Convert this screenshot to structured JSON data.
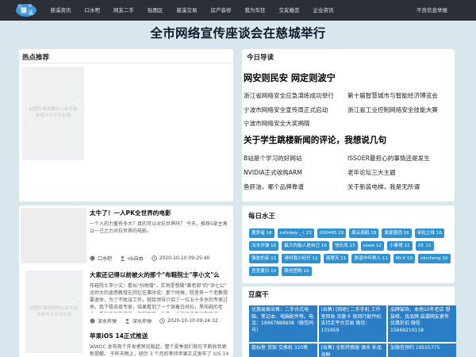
{
  "topbar": {
    "nav": [
      "慈溪资讯",
      "口水吧",
      "网友二手",
      "贴图区",
      "慈溪交易",
      "房产装修",
      "我为车狂",
      "交友婚恋",
      "企业资讯"
    ],
    "report": "不良信息举报"
  },
  "headline": "全市网络宣传座谈会在慈城举行",
  "hot": {
    "title": "热点推荐",
    "placeholder": [
      "此图片来自微信公众平台",
      "未经允许不可引用"
    ]
  },
  "guide": {
    "title": "今日导读",
    "h1a": "网安则民安 网定则波宁",
    "links_a": [
      "浙江省网络安全应急演练成功举行",
      "第十届智慧城市与智能经济博览会",
      "宁波市网络安全宣传周正式启动",
      "浙江省工业控制网络安全技能大赛",
      "宁波市网络安全大奖揭晓"
    ],
    "h1b": "关于学生跳楼新闻的评论，我想说几句",
    "links_b": [
      "B站是个学习的好网站",
      "ISSOER最担心的事情还是发生",
      "NVIDIA正式收购ARM",
      "老年论坛三大主题",
      "鱼肝油，哪个品牌靠谱",
      "关于新装电梯，我是无所谓"
    ]
  },
  "articles": [
    {
      "title": "太牛了！一人PK全世界的电影",
      "desc": "一个人的力量有多大？真的可以对抗世界吗？ 今天，推荐5部主角以一己之力对抗世界的电影。",
      "section": "口水吧",
      "author": "nb自由",
      "time": "2020-10-10 09:25:40"
    },
    {
      "title": "大家还记得以前被火的那个\"布鞋院士\"李小文\"么",
      "desc": "布鞋院士李小文：看似\"扫地僧\"，实则是想做\"黄老邪\"的\"洪七公\" 北师大的遥感教授在回忆往事时说：那个时候，院里有一个老教授要退休，为了不耽误工作，就给领导介绍了一位五十多岁的专家过来。我下楼去接专家，结果看到了一个穿着白衬衫，黑布鞋的老头，看起来有些邋遢，相貌平平，站在一个破旧的自行车旁边。",
      "placeholder": [
        "此图片来自微信公众平台",
        "未经允许不可引用"
      ],
      "section": "深水炸弹",
      "author": "深水炸弹",
      "time": "2020-10-10 09:24:32"
    },
    {
      "title": "苹果iOS 14正式推送",
      "desc": "WWDC 发布首个开发者预览版起，整个夏季我们就在不断收到更新提醒。 于昨天晚上，经历 3 个月的等待苹果正式发布了 iOS 14 正式版。",
      "section": "",
      "author": "",
      "time": ""
    }
  ],
  "water": {
    "title": "每日水王",
    "tags": [
      "噩梦者 16",
      "m0nkey-_-! 23",
      "000495 20",
      "周云孤鹤 18",
      "紫夏版团 16",
      "米粒之珠 16",
      "深水炸弹 16",
      "最大的敌人是自己 16",
      "快乐风 13",
      "sowe 12",
      "小秦哥 11",
      "XP. 11",
      "骆驼的亲 11",
      "请叫我小旺仔 11",
      "翡翠天 11",
      "厚道中年男人 11",
      "Mr.V 10",
      "xincheng 10",
      "查查夏日 10",
      "联创团购 10"
    ]
  },
  "tofu": {
    "title": "豆腐干",
    "ads": [
      "优惠易索出售：二手台式电脑、笔记本、电脑配件等。电话：18967888808（微信同号）",
      "(出售) [回收] 二手手机 工作室回收 流量卡 接回行配件机 支持走平台交易 微信：131659",
      "品牌装饰，本地10年老店 想装修，找品牌,装漏网友更有优惠折扣 微信15669219118",
      "鼠标垫 货架 交换机 320笔",
      "[出售] 全新转换版 酒水 补品 海鲜",
      "加微信预约 19555775"
    ]
  },
  "colors": {
    "topbar": "#2b3036",
    "background": "#d8e6ee",
    "accent": "#2f93d3",
    "ad": "#2a7ec6"
  }
}
